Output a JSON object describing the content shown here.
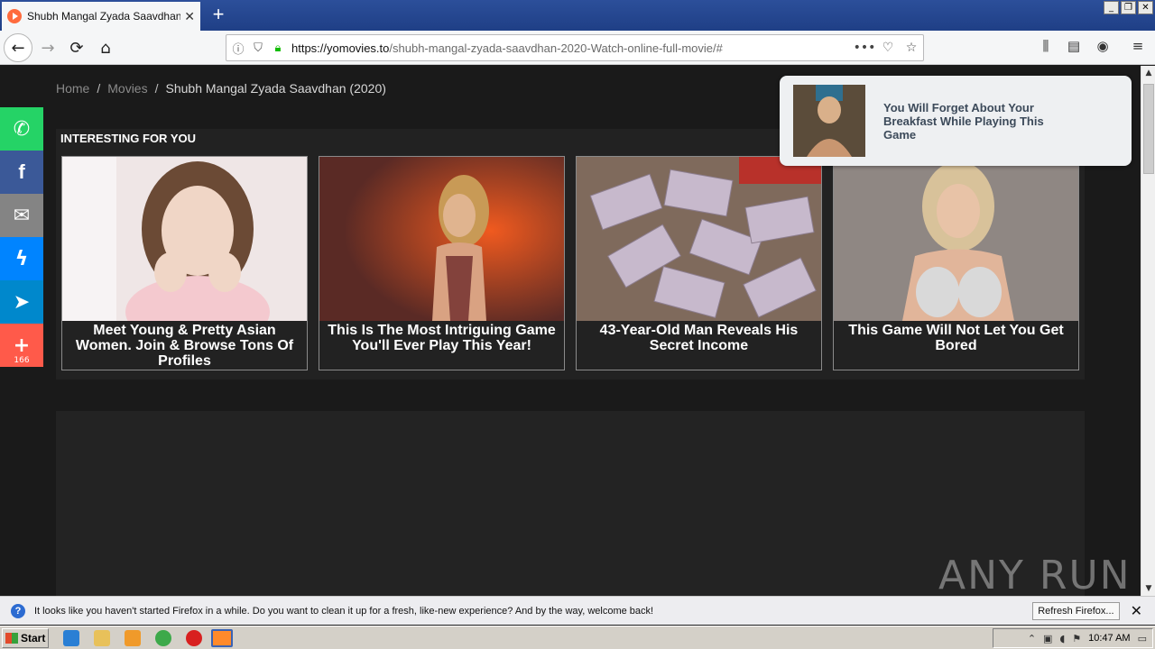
{
  "browser": {
    "tab_title": "Shubh Mangal Zyada Saavdhan (2",
    "tab_close": "✕",
    "new_tab": "+",
    "url_host": "https://yomovies.to",
    "url_path": "/shubh-mangal-zyada-saavdhan-2020-Watch-online-full-movie/#",
    "window_buttons": [
      "_",
      "❐",
      "✕"
    ]
  },
  "breadcrumb": {
    "home": "Home",
    "movies": "Movies",
    "sep": "/",
    "current": "Shubh Mangal Zyada Saavdhan (2020)"
  },
  "recommendations": {
    "title": "INTERESTING FOR YOU",
    "items": [
      {
        "caption": "Meet Young & Pretty Asian Women. Join & Browse Tons Of Profiles",
        "color": "#e8d7d2"
      },
      {
        "caption": "This Is The Most Intriguing Game You'll Ever Play This Year!",
        "color": "#a3472f"
      },
      {
        "caption": "43-Year-Old Man Reveals His Secret Income",
        "color": "#8b7a73"
      },
      {
        "caption": "This Game Will Not Let You Get Bored",
        "color": "#8d847f"
      }
    ]
  },
  "popup": {
    "text": "You Will Forget About Your Breakfast While Playing This Game"
  },
  "share": {
    "count": "166",
    "colors": {
      "whatsapp": "#25d366",
      "facebook": "#3b5998",
      "email": "#848484",
      "messenger": "#0084ff",
      "telegram": "#0088cc",
      "more": "#ff5a4a"
    }
  },
  "notification": {
    "message": "It looks like you haven't started Firefox in a while. Do you want to clean it up for a fresh, like-new experience? And by the way, welcome back!",
    "button": "Refresh Firefox...",
    "close": "✕"
  },
  "watermark": "ANY RUN",
  "taskbar": {
    "start": "Start",
    "time": "10:47 AM"
  }
}
